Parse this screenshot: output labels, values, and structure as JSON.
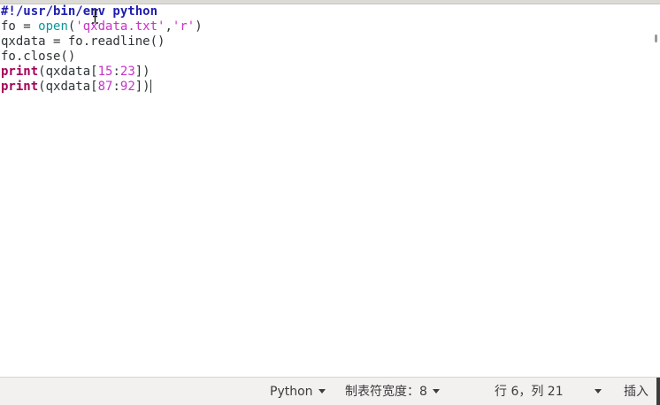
{
  "editor": {
    "lines": [
      {
        "tokens": [
          {
            "t": "#!/usr/bin/env python",
            "c": "shebang"
          }
        ]
      },
      {
        "tokens": [
          {
            "t": "fo = ",
            "c": ""
          },
          {
            "t": "open",
            "c": "builtin"
          },
          {
            "t": "(",
            "c": ""
          },
          {
            "t": "'qxdata.txt'",
            "c": "str"
          },
          {
            "t": ",",
            "c": ""
          },
          {
            "t": "'r'",
            "c": "str"
          },
          {
            "t": ")",
            "c": ""
          }
        ]
      },
      {
        "tokens": [
          {
            "t": "qxdata = fo.readline()",
            "c": ""
          }
        ]
      },
      {
        "tokens": [
          {
            "t": "fo.close()",
            "c": ""
          }
        ]
      },
      {
        "tokens": [
          {
            "t": "print",
            "c": "kw"
          },
          {
            "t": "(qxdata[",
            "c": ""
          },
          {
            "t": "15",
            "c": "num"
          },
          {
            "t": ":",
            "c": ""
          },
          {
            "t": "23",
            "c": "num"
          },
          {
            "t": "])",
            "c": ""
          }
        ]
      },
      {
        "tokens": [
          {
            "t": "print",
            "c": "kw"
          },
          {
            "t": "(qxdata[",
            "c": ""
          },
          {
            "t": "87",
            "c": "num"
          },
          {
            "t": ":",
            "c": ""
          },
          {
            "t": "92",
            "c": "num"
          },
          {
            "t": "])",
            "c": ""
          }
        ],
        "caret": true
      }
    ]
  },
  "statusbar": {
    "language": "Python",
    "tab_width": "制表符宽度：8",
    "cursor_position": "行 6，列 21",
    "insert_mode": "插入"
  },
  "colors": {
    "shebang": "#1e1eaf",
    "builtin": "#06989a",
    "string": "#c732c7",
    "keyword": "#a40058",
    "text": "#2e3436",
    "statusbar_bg": "#f2f1f0"
  },
  "icons": {
    "mouse_cursor": "ibeam-cursor-icon",
    "dropdown": "triangle-down-icon"
  }
}
